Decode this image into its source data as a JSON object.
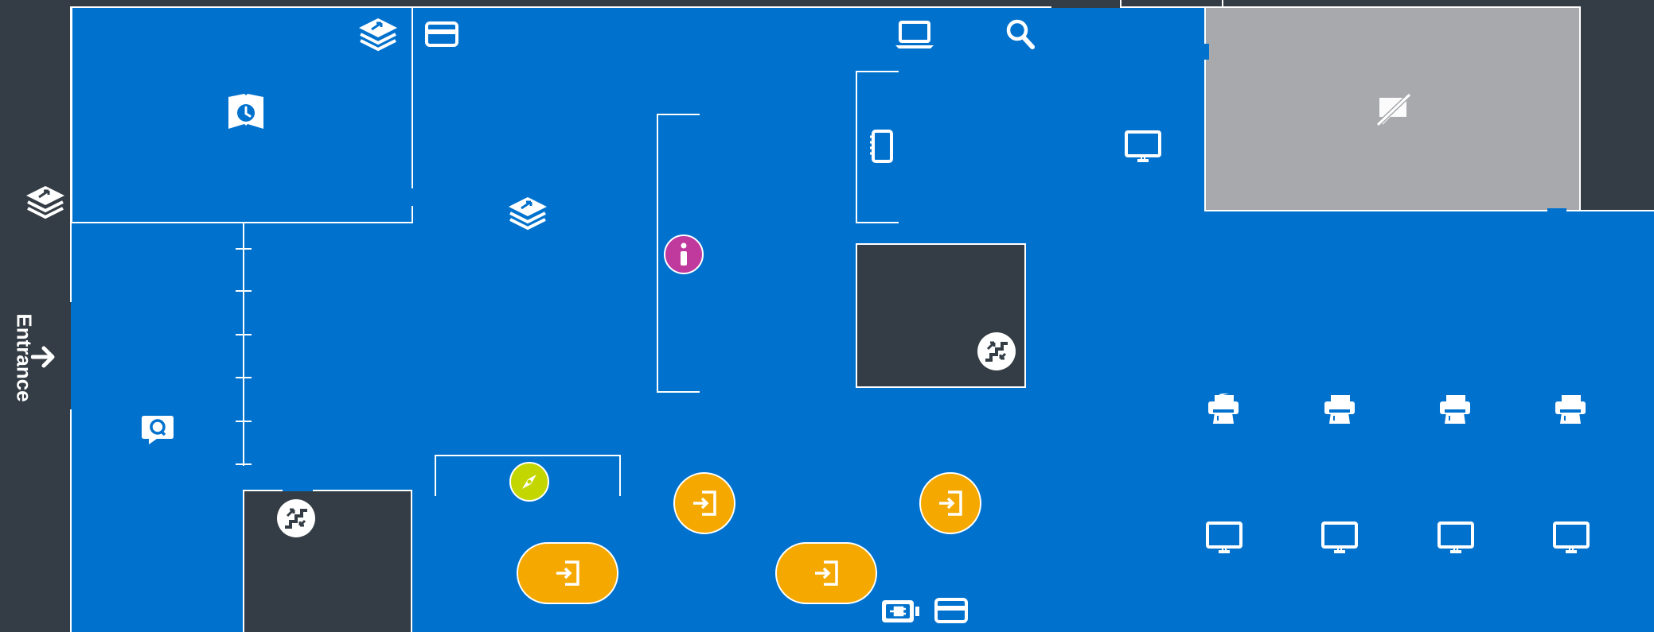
{
  "map": {
    "entrance_label": "Entrance",
    "colors": {
      "floor": "#0072ce",
      "background": "#343d45",
      "closed_area": "#a7a9ac",
      "entry_button": "#f5a800",
      "info_marker": "#c0399d",
      "compass_marker": "#c4d600",
      "lines": "#ffffff"
    },
    "icons": [
      "learning-hub-icon",
      "card-reader-icon",
      "laptop-icon",
      "search-icon",
      "entrance-learning-hub-icon",
      "study-room-icon",
      "notebook-icon",
      "monitor-icon",
      "restricted-area-icon",
      "info-icon",
      "stairs-icon",
      "chat-help-icon",
      "compass-icon",
      "entry-icon",
      "battery-charger-icon",
      "printer-icon"
    ]
  }
}
